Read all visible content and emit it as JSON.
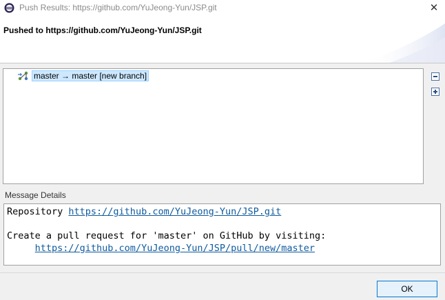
{
  "window": {
    "title": "Push Results: https://github.com/YuJeong-Yun/JSP.git",
    "close_glyph": "✕"
  },
  "header": {
    "title": "Pushed to https://github.com/YuJeong-Yun/JSP.git"
  },
  "tree": {
    "items": [
      {
        "label": "master → master [new branch]",
        "icon": "branch-icon"
      }
    ]
  },
  "message": {
    "label": "Message Details",
    "repo_prefix": "Repository ",
    "repo_url": "https://github.com/YuJeong-Yun/JSP.git",
    "pr_text": "Create a pull request for 'master' on GitHub by visiting:",
    "pr_indent": "     ",
    "pr_url": "https://github.com/YuJeong-Yun/JSP/pull/new/master"
  },
  "footer": {
    "ok_label": "OK"
  },
  "colors": {
    "selection_bg": "#cde8ff",
    "link": "#0e5a9e",
    "ok_border": "#0078d7"
  }
}
